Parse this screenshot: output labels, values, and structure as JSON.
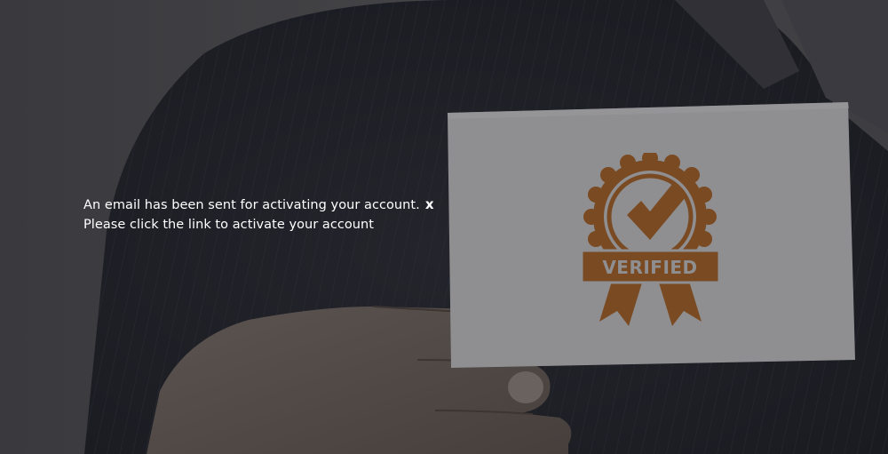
{
  "notification": {
    "line1": "An email has been sent for activating your account.",
    "line2": "Please click the link to activate your account",
    "close_label": "x"
  },
  "card": {
    "badge_text": "VERIFIED"
  },
  "colors": {
    "badge": "#7a4a22",
    "card": "#8f8f91",
    "text": "#ffffff",
    "background": "#2c2c30"
  },
  "icons": {
    "badge": "verified-seal-icon",
    "check": "checkmark-icon",
    "close": "close-icon"
  }
}
